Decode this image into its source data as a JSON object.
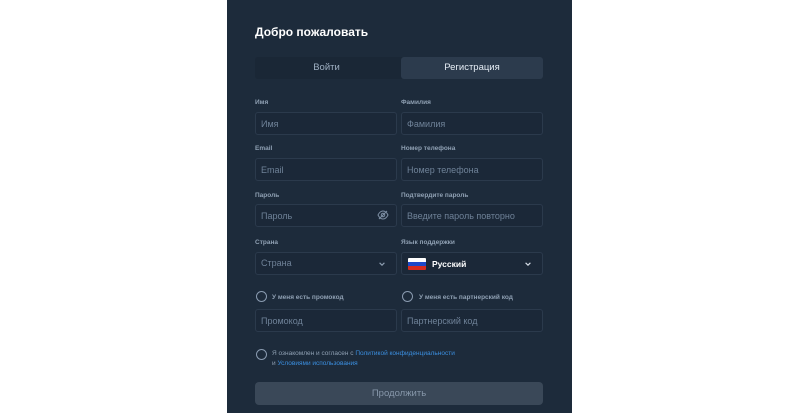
{
  "title": "Добро пожаловать",
  "tabs": {
    "login": "Войти",
    "register": "Регистрация"
  },
  "fields": {
    "first_name": {
      "label": "Имя",
      "placeholder": "Имя"
    },
    "last_name": {
      "label": "Фамилия",
      "placeholder": "Фамилия"
    },
    "email": {
      "label": "Email",
      "placeholder": "Email"
    },
    "phone": {
      "label": "Номер телефона",
      "placeholder": "Номер телефона"
    },
    "password": {
      "label": "Пароль",
      "placeholder": "Пароль"
    },
    "confirm_password": {
      "label": "Подтвердите пароль",
      "placeholder": "Введите пароль повторно"
    },
    "country": {
      "label": "Страна",
      "value": "Страна"
    },
    "support_language": {
      "label": "Язык поддержки",
      "value": "Русский"
    },
    "promo": {
      "checkbox_label": "У меня есть промокод",
      "placeholder": "Промокод"
    },
    "partner": {
      "checkbox_label": "У меня есть партнерский код",
      "placeholder": "Партнерский код"
    }
  },
  "agreement": {
    "prefix": "Я ознакомлен и согласен с",
    "privacy_link": "Политикой конфиденциальности",
    "conjunction": "и",
    "terms_link": "Условиями использования"
  },
  "continue_button": "Продолжить",
  "icons": {
    "password_toggle": "eye-off-icon",
    "dropdown": "chevron-down-icon",
    "flag": "russia-flag-icon"
  },
  "colors": {
    "panel_bg": "#1d2b3b",
    "input_bg": "#1b2838",
    "link": "#3b8fe0",
    "button_bg": "#3a4858"
  }
}
